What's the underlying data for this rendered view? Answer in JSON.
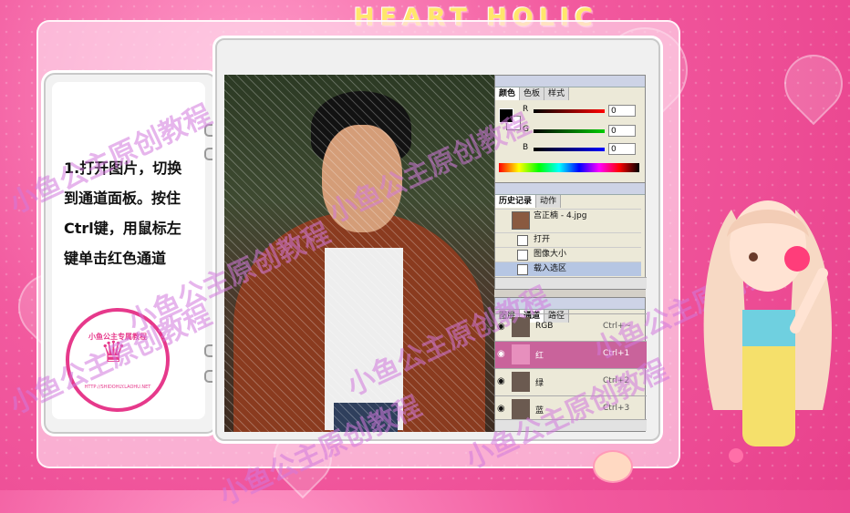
{
  "brand": {
    "logo_text": "HEART HOLIC"
  },
  "tutorial": {
    "lines": [
      "1.打开图片，切换",
      "到通道面板。按住",
      "Ctrl键，用鼠标左",
      "键单击红色通道"
    ],
    "seal_title": "小鱼公主专属教程",
    "seal_url": "HTTP://SHIDOHLY.LAOHU.NET"
  },
  "watermark": "小鱼公主原创教程",
  "color_palette": {
    "tabs": [
      "颜色",
      "色板",
      "样式"
    ],
    "channels": [
      {
        "label": "R",
        "value": "0",
        "color": "#d01010"
      },
      {
        "label": "G",
        "value": "0",
        "color": "#10a010"
      },
      {
        "label": "B",
        "value": "0",
        "color": "#1030d0"
      }
    ]
  },
  "history_palette": {
    "tabs": [
      "历史记录",
      "动作"
    ],
    "snapshot": "宫正楠 - 4.jpg",
    "items": [
      "打开",
      "图像大小",
      "载入选区"
    ]
  },
  "channels_palette": {
    "tabs": [
      "图层",
      "通道",
      "路径"
    ],
    "rows": [
      {
        "name": "RGB",
        "shortcut": "Ctrl+~"
      },
      {
        "name": "红",
        "shortcut": "Ctrl+1"
      },
      {
        "name": "绿",
        "shortcut": "Ctrl+2"
      },
      {
        "name": "蓝",
        "shortcut": "Ctrl+3"
      }
    ]
  },
  "colors": {
    "accent": "#e6398b",
    "selected_channel": "#c9639b"
  }
}
